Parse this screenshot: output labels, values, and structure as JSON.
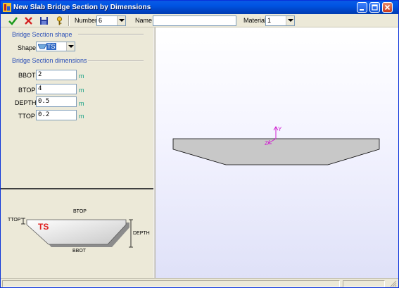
{
  "window": {
    "title": "New  Slab Bridge Section by Dimensions"
  },
  "toolbar": {
    "number_label": "Number",
    "number_value": "6",
    "name_label": "Name",
    "name_value": "",
    "material_label": "Material",
    "material_value": "1"
  },
  "shape_group": {
    "title": "Bridge Section shape",
    "shape_label": "Shape",
    "shape_value": "TS"
  },
  "dimensions_group": {
    "title": "Bridge Section dimensions",
    "fields": [
      {
        "label": "BBOT",
        "value": "2",
        "unit": "m"
      },
      {
        "label": "BTOP",
        "value": "4",
        "unit": "m"
      },
      {
        "label": "DEPTH",
        "value": "0.5",
        "unit": "m"
      },
      {
        "label": "TTOP",
        "value": "0.2",
        "unit": "m"
      }
    ]
  },
  "diagram": {
    "btop": "BTOP",
    "bbot": "BBOT",
    "depth": "DEPTH",
    "ttop": "TTOP",
    "shape_code": "TS",
    "shape_code_color": "#e02020"
  },
  "viewport": {
    "axis_y": "Y",
    "axis_z": "Z",
    "axis_color": "#d01fd0"
  },
  "colors": {
    "title_bar": "#0054e3",
    "group_title": "#2b4fb7",
    "unit": "#16a085"
  }
}
